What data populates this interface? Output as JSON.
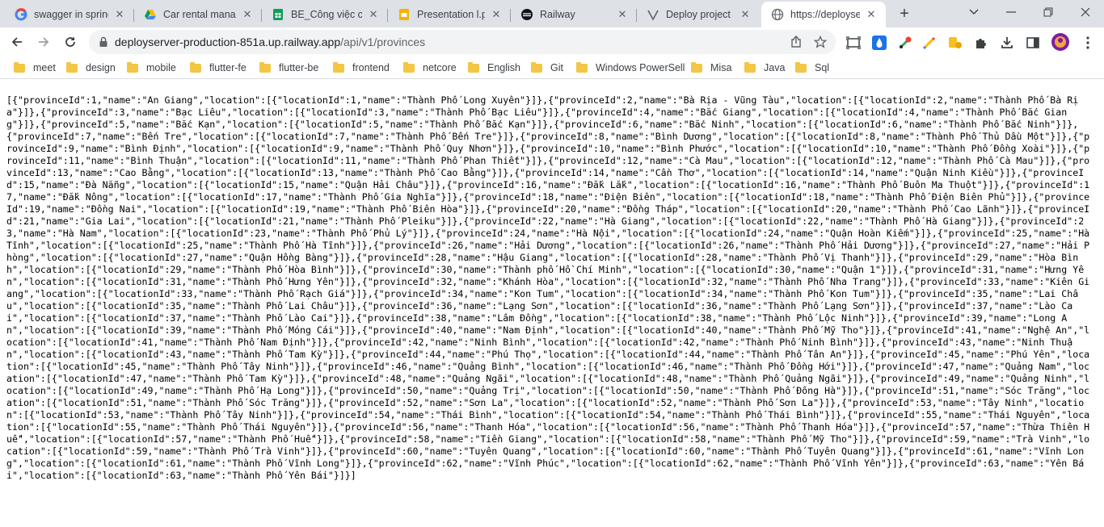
{
  "tabs": [
    {
      "title": "swagger in spring",
      "icon": "google-icon",
      "active": false
    },
    {
      "title": "Car rental manag",
      "icon": "google-drive-icon",
      "active": false
    },
    {
      "title": "BE_Công việc các",
      "icon": "google-sheets-icon",
      "active": false
    },
    {
      "title": "Presentation l.pp",
      "icon": "slides-icon",
      "active": false
    },
    {
      "title": "Railway",
      "icon": "railway-icon",
      "active": false
    },
    {
      "title": "Deploy project L",
      "icon": "vercel-icon",
      "active": false
    },
    {
      "title": "https://deployser",
      "icon": "globe-icon",
      "active": true
    }
  ],
  "address_bar": {
    "host": "deployserver-production-851a.up.railway.app",
    "path": "/api/v1/provinces"
  },
  "bookmarks": [
    "meet",
    "design",
    "mobile",
    "flutter-fe",
    "flutter-be",
    "frontend",
    "netcore",
    "English",
    "Git",
    "Windows PowerSell",
    "Misa",
    "Java",
    "Sql"
  ],
  "response_body": "[{\"provinceId\":1,\"name\":\"An Giang\",\"location\":[{\"locationId\":1,\"name\":\"Thành Phố Long Xuyên\"}]},{\"provinceId\":2,\"name\":\"Bà Rịa - Vũng Tàu\",\"location\":[{\"locationId\":2,\"name\":\"Thành Phố Bà Rịa\"}]},{\"provinceId\":3,\"name\":\"Bạc Liêu\",\"location\":[{\"locationId\":3,\"name\":\"Thành Phố Bạc Liêu\"}]},{\"provinceId\":4,\"name\":\"Bắc Giang\",\"location\":[{\"locationId\":4,\"name\":\"Thành Phố Bắc Giang\"}]},{\"provinceId\":5,\"name\":\"Bắc Kạn\",\"location\":[{\"locationId\":5,\"name\":\"Thành Phố Bắc Kạn\"}]},{\"provinceId\":6,\"name\":\"Bắc Ninh\",\"location\":[{\"locationId\":6,\"name\":\"Thành Phố Bắc Ninh\"}]},{\"provinceId\":7,\"name\":\"Bến Tre\",\"location\":[{\"locationId\":7,\"name\":\"Thành Phố Bến Tre\"}]},{\"provinceId\":8,\"name\":\"Bình Dương\",\"location\":[{\"locationId\":8,\"name\":\"Thành Phố Thủ Dầu Một\"}]},{\"provinceId\":9,\"name\":\"Bình Định\",\"location\":[{\"locationId\":9,\"name\":\"Thành Phố Quy Nhơn\"}]},{\"provinceId\":10,\"name\":\"Bình Phước\",\"location\":[{\"locationId\":10,\"name\":\"Thành Phố Đồng Xoài\"}]},{\"provinceId\":11,\"name\":\"Bình Thuận\",\"location\":[{\"locationId\":11,\"name\":\"Thành Phố Phan Thiết\"}]},{\"provinceId\":12,\"name\":\"Cà Mau\",\"location\":[{\"locationId\":12,\"name\":\"Thành Phố Cà Mau\"}]},{\"provinceId\":13,\"name\":\"Cao Bằng\",\"location\":[{\"locationId\":13,\"name\":\"Thành Phố Cao Bằng\"}]},{\"provinceId\":14,\"name\":\"Cần Thơ\",\"location\":[{\"locationId\":14,\"name\":\"Quận Ninh Kiều\"}]},{\"provinceId\":15,\"name\":\"Đà Nẵng\",\"location\":[{\"locationId\":15,\"name\":\"Quận Hải Châu\"}]},{\"provinceId\":16,\"name\":\"Đắk Lắk\",\"location\":[{\"locationId\":16,\"name\":\"Thành Phố Buôn Ma Thuột\"}]},{\"provinceId\":17,\"name\":\"Đắk Nông\",\"location\":[{\"locationId\":17,\"name\":\"Thành Phố Gia Nghĩa\"}]},{\"provinceId\":18,\"name\":\"Điện Biên\",\"location\":[{\"locationId\":18,\"name\":\"Thành Phố Điện Biên Phủ\"}]},{\"provinceId\":19,\"name\":\"Đồng Nai\",\"location\":[{\"locationId\":19,\"name\":\"Thành Phố Biên Hòa\"}]},{\"provinceId\":20,\"name\":\"Đồng Tháp\",\"location\":[{\"locationId\":20,\"name\":\"Thành Phố Cao Lãnh\"}]},{\"provinceId\":21,\"name\":\"Gia Lai\",\"location\":[{\"locationId\":21,\"name\":\"Thành Phố Pleiku\"}]},{\"provinceId\":22,\"name\":\"Hà Giang\",\"location\":[{\"locationId\":22,\"name\":\"Thành Phố Hà Giang\"}]},{\"provinceId\":23,\"name\":\"Hà Nam\",\"location\":[{\"locationId\":23,\"name\":\"Thành Phố Phủ Lý\"}]},{\"provinceId\":24,\"name\":\"Hà Nội\",\"location\":[{\"locationId\":24,\"name\":\"Quận Hoàn Kiếm\"}]},{\"provinceId\":25,\"name\":\"Hà Tĩnh\",\"location\":[{\"locationId\":25,\"name\":\"Thành Phố Hà Tĩnh\"}]},{\"provinceId\":26,\"name\":\"Hải Dương\",\"location\":[{\"locationId\":26,\"name\":\"Thành Phố Hải Dương\"}]},{\"provinceId\":27,\"name\":\"Hải Phòng\",\"location\":[{\"locationId\":27,\"name\":\"Quận Hồng Bàng\"}]},{\"provinceId\":28,\"name\":\"Hậu Giang\",\"location\":[{\"locationId\":28,\"name\":\"Thành Phố Vị Thanh\"}]},{\"provinceId\":29,\"name\":\"Hòa Bình\",\"location\":[{\"locationId\":29,\"name\":\"Thành Phố Hòa Bình\"}]},{\"provinceId\":30,\"name\":\"Thành phố Hồ Chí Minh\",\"location\":[{\"locationId\":30,\"name\":\"Quận 1\"}]},{\"provinceId\":31,\"name\":\"Hưng Yên\",\"location\":[{\"locationId\":31,\"name\":\"Thành Phố Hưng Yên\"}]},{\"provinceId\":32,\"name\":\"Khánh Hòa\",\"location\":[{\"locationId\":32,\"name\":\"Thành Phố Nha Trang\"}]},{\"provinceId\":33,\"name\":\"Kiên Giang\",\"location\":[{\"locationId\":33,\"name\":\"Thành Phố Rạch Giá\"}]},{\"provinceId\":34,\"name\":\"Kon Tum\",\"location\":[{\"locationId\":34,\"name\":\"Thành Phố Kon Tum\"}]},{\"provinceId\":35,\"name\":\"Lai Châu\",\"location\":[{\"locationId\":35,\"name\":\"Thành Phố Lai Châu\"}]},{\"provinceId\":36,\"name\":\"Lạng Sơn\",\"location\":[{\"locationId\":36,\"name\":\"Thành Phố Lạng Sơn\"}]},{\"provinceId\":37,\"name\":\"Lào Cai\",\"location\":[{\"locationId\":37,\"name\":\"Thành Phố Lào Cai\"}]},{\"provinceId\":38,\"name\":\"Lâm Đồng\",\"location\":[{\"locationId\":38,\"name\":\"Thành Phố Lộc Ninh\"}]},{\"provinceId\":39,\"name\":\"Long An\",\"location\":[{\"locationId\":39,\"name\":\"Thành Phố Móng Cái\"}]},{\"provinceId\":40,\"name\":\"Nam Định\",\"location\":[{\"locationId\":40,\"name\":\"Thành Phố Mỹ Tho\"}]},{\"provinceId\":41,\"name\":\"Nghệ An\",\"location\":[{\"locationId\":41,\"name\":\"Thành Phố Nam Định\"}]},{\"provinceId\":42,\"name\":\"Ninh Bình\",\"location\":[{\"locationId\":42,\"name\":\"Thành Phố Ninh Bình\"}]},{\"provinceId\":43,\"name\":\"Ninh Thuận\",\"location\":[{\"locationId\":43,\"name\":\"Thành Phố Tam Kỳ\"}]},{\"provinceId\":44,\"name\":\"Phú Thọ\",\"location\":[{\"locationId\":44,\"name\":\"Thành Phố Tân An\"}]},{\"provinceId\":45,\"name\":\"Phú Yên\",\"location\":[{\"locationId\":45,\"name\":\"Thành Phố Tây Ninh\"}]},{\"provinceId\":46,\"name\":\"Quảng Bình\",\"location\":[{\"locationId\":46,\"name\":\"Thành Phố Đồng Hới\"}]},{\"provinceId\":47,\"name\":\"Quảng Nam\",\"location\":[{\"locationId\":47,\"name\":\"Thành Phố Tam Kỳ\"}]},{\"provinceId\":48,\"name\":\"Quảng Ngãi\",\"location\":[{\"locationId\":48,\"name\":\"Thành Phố Quảng Ngãi\"}]},{\"provinceId\":49,\"name\":\"Quảng Ninh\",\"location\":[{\"locationId\":49,\"name\":\"Thành Phố Hạ Long\"}]},{\"provinceId\":50,\"name\":\"Quảng Trị\",\"location\":[{\"locationId\":50,\"name\":\"Thành Phố Đông Hà\"}]},{\"provinceId\":51,\"name\":\"Sóc Trăng\",\"location\":[{\"locationId\":51,\"name\":\"Thành Phố Sóc Trăng\"}]},{\"provinceId\":52,\"name\":\"Sơn La\",\"location\":[{\"locationId\":52,\"name\":\"Thành Phố Sơn La\"}]},{\"provinceId\":53,\"name\":\"Tây Ninh\",\"location\":[{\"locationId\":53,\"name\":\"Thành Phố Tây Ninh\"}]},{\"provinceId\":54,\"name\":\"Thái Bình\",\"location\":[{\"locationId\":54,\"name\":\"Thành Phố Thái Bình\"}]},{\"provinceId\":55,\"name\":\"Thái Nguyên\",\"location\":[{\"locationId\":55,\"name\":\"Thành Phố Thái Nguyên\"}]},{\"provinceId\":56,\"name\":\"Thanh Hóa\",\"location\":[{\"locationId\":56,\"name\":\"Thành Phố Thanh Hóa\"}]},{\"provinceId\":57,\"name\":\"Thừa Thiên Huế\",\"location\":[{\"locationId\":57,\"name\":\"Thành Phố Huế\"}]},{\"provinceId\":58,\"name\":\"Tiền Giang\",\"location\":[{\"locationId\":58,\"name\":\"Thành Phố Mỹ Tho\"}]},{\"provinceId\":59,\"name\":\"Trà Vinh\",\"location\":[{\"locationId\":59,\"name\":\"Thành Phố Trà Vinh\"}]},{\"provinceId\":60,\"name\":\"Tuyên Quang\",\"location\":[{\"locationId\":60,\"name\":\"Thành Phố Tuyên Quang\"}]},{\"provinceId\":61,\"name\":\"Vĩnh Long\",\"location\":[{\"locationId\":61,\"name\":\"Thành Phố Vĩnh Long\"}]},{\"provinceId\":62,\"name\":\"Vĩnh Phúc\",\"location\":[{\"locationId\":62,\"name\":\"Thành Phố Vĩnh Yên\"}]},{\"provinceId\":63,\"name\":\"Yên Bái\",\"location\":[{\"locationId\":63,\"name\":\"Thành Phố Yên Bái\"}]}]"
}
